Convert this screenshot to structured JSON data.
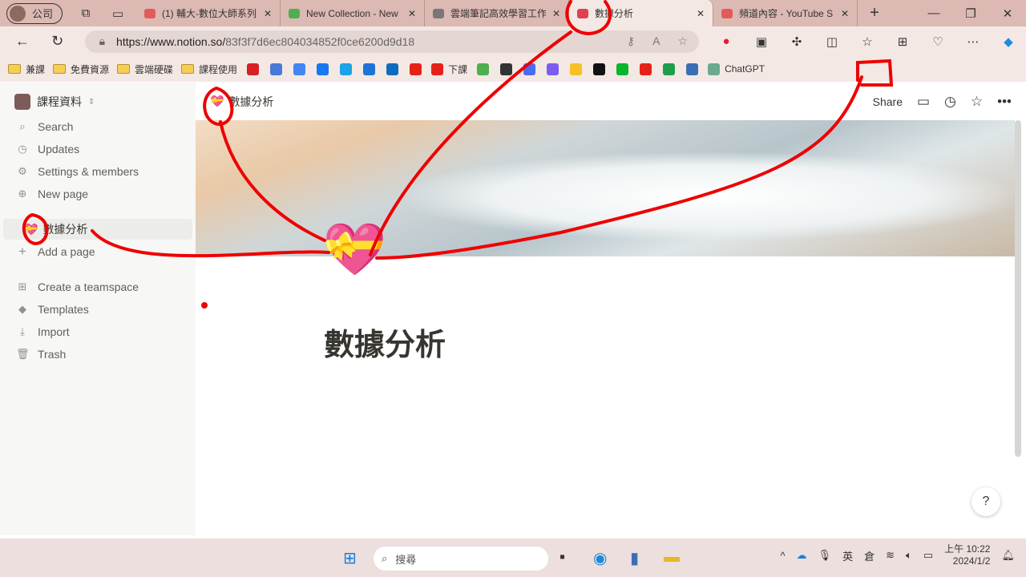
{
  "browser": {
    "profile": "公司",
    "tabs": [
      {
        "label": "(1) 輔大-數位大師系列",
        "favicon": "youtube-icon",
        "color": "#e25b5b"
      },
      {
        "label": "New Collection - New",
        "favicon": "raindrop-icon",
        "color": "#4caf50"
      },
      {
        "label": "雲端筆記高效學習工作",
        "favicon": "document-icon",
        "color": "#777777"
      },
      {
        "label": "數據分析",
        "favicon": "heart-gift-icon",
        "color": "#e04050",
        "active": true
      },
      {
        "label": "頻道內容 - YouTube S",
        "favicon": "youtube-icon",
        "color": "#e25b5b"
      }
    ],
    "url_host": "https://www.notion.so/",
    "url_path": "83f3f7d6ec804034852f0ce6200d9d18",
    "bookmarks_folders": [
      "兼課",
      "免費資源",
      "雲端硬碟",
      "課程使用"
    ],
    "bookmark_icons": [
      {
        "name": "netflix",
        "color": "#d81f26"
      },
      {
        "name": "gmail",
        "color": "#4a78d8"
      },
      {
        "name": "calendar",
        "color": "#4285f4"
      },
      {
        "name": "facebook",
        "color": "#1877f2"
      },
      {
        "name": "music",
        "color": "#1aa3e8"
      },
      {
        "name": "u-app",
        "color": "#1c74d9"
      },
      {
        "name": "onedrive",
        "color": "#0f6cbd"
      },
      {
        "name": "youtube",
        "color": "#e62117"
      }
    ],
    "bookmark_mid": "下課",
    "bookmark_icons2": [
      {
        "name": "raindrop",
        "color": "#4caf50"
      },
      {
        "name": "docs",
        "color": "#333333"
      },
      {
        "name": "canva",
        "color": "#4b6bf0"
      },
      {
        "name": "copilot",
        "color": "#7b5cf0"
      },
      {
        "name": "keep",
        "color": "#f6c026"
      },
      {
        "name": "notion",
        "color": "#111111"
      },
      {
        "name": "line",
        "color": "#08b52b"
      },
      {
        "name": "youtube",
        "color": "#e62117"
      },
      {
        "name": "plus",
        "color": "#1e9e4a"
      },
      {
        "name": "a-app",
        "color": "#3a6fb5"
      }
    ],
    "bookmark_last": "ChatGPT"
  },
  "sidebar": {
    "workspace": "課程資料",
    "items": [
      {
        "label": "Search",
        "icon": "search-icon",
        "glyph": "⌕"
      },
      {
        "label": "Updates",
        "icon": "clock-icon",
        "glyph": "◷"
      },
      {
        "label": "Settings & members",
        "icon": "gear-icon",
        "glyph": "⚙"
      },
      {
        "label": "New page",
        "icon": "plus-circle-icon",
        "glyph": "⊕"
      }
    ],
    "page": "數據分析",
    "add_page": "Add a page",
    "items2": [
      {
        "label": "Create a teamspace",
        "icon": "teamspace-icon",
        "glyph": "⊞"
      },
      {
        "label": "Templates",
        "icon": "templates-icon",
        "glyph": "◆"
      },
      {
        "label": "Import",
        "icon": "import-icon",
        "glyph": "⤓"
      },
      {
        "label": "Trash",
        "icon": "trash-icon",
        "glyph": "🗑"
      }
    ]
  },
  "page": {
    "breadcrumb": "數據分析",
    "share": "Share",
    "title": "數據分析",
    "help": "?"
  },
  "taskbar": {
    "search_placeholder": "搜尋",
    "ime1": "英",
    "ime2": "倉",
    "time": "上午 10:22",
    "date": "2024/1/2"
  },
  "annotation_color": "#ee0000"
}
